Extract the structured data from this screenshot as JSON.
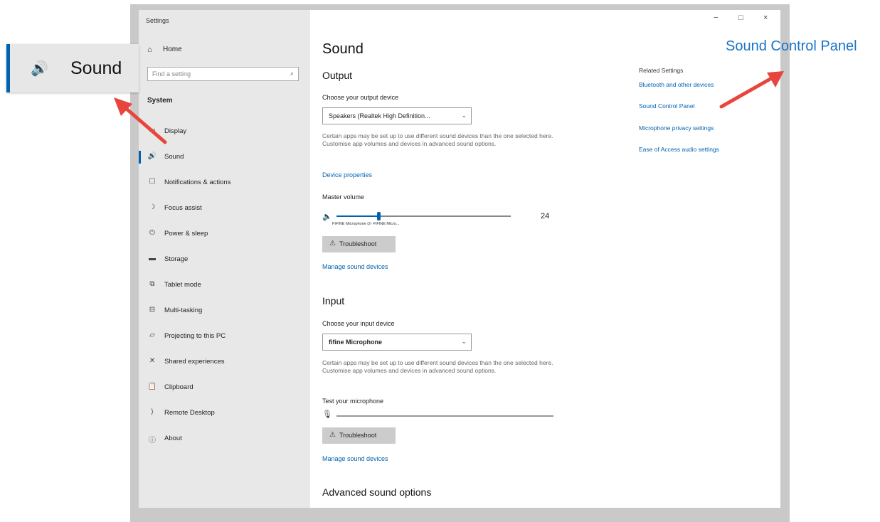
{
  "window": {
    "title": "Settings",
    "controls": {
      "minimize": "−",
      "maximize": "□",
      "close": "×"
    }
  },
  "sidebar": {
    "home_label": "Home",
    "home_icon": "home-icon",
    "search_placeholder": "Find a setting",
    "section_heading": "System",
    "items": [
      {
        "label": "Display",
        "icon": "display-icon",
        "glyph": "▭",
        "active": false
      },
      {
        "label": "Sound",
        "icon": "speaker-icon",
        "glyph": "🔊",
        "active": true
      },
      {
        "label": "Notifications & actions",
        "icon": "notifications-icon",
        "glyph": "☐",
        "active": false
      },
      {
        "label": "Focus assist",
        "icon": "moon-icon",
        "glyph": "☽",
        "active": false
      },
      {
        "label": "Power & sleep",
        "icon": "power-icon",
        "glyph": "⏻",
        "active": false
      },
      {
        "label": "Storage",
        "icon": "storage-icon",
        "glyph": "▬",
        "active": false
      },
      {
        "label": "Tablet mode",
        "icon": "tablet-icon",
        "glyph": "⧉",
        "active": false
      },
      {
        "label": "Multi-tasking",
        "icon": "multitask-icon",
        "glyph": "⊟",
        "active": false
      },
      {
        "label": "Projecting to this PC",
        "icon": "projecting-icon",
        "glyph": "▱",
        "active": false
      },
      {
        "label": "Shared experiences",
        "icon": "shared-icon",
        "glyph": "✕",
        "active": false
      },
      {
        "label": "Clipboard",
        "icon": "clipboard-icon",
        "glyph": "📋",
        "active": false
      },
      {
        "label": "Remote Desktop",
        "icon": "remote-desktop-icon",
        "glyph": "⟩",
        "active": false
      },
      {
        "label": "About",
        "icon": "info-icon",
        "glyph": "ⓘ",
        "active": false
      }
    ]
  },
  "main": {
    "title": "Sound",
    "output": {
      "heading": "Output",
      "choose_label": "Choose your output device",
      "device_value": "Speakers (Realtek High Definition...",
      "description": "Certain apps may be set up to use different sound devices than the one selected here. Customise app volumes and devices in advanced sound options.",
      "device_properties_link": "Device properties",
      "master_volume_label": "Master volume",
      "volume_value": "24",
      "volume_level": 0.24,
      "volume_sublabel": "FIFINE Microphone (2- FIFINE Micro...",
      "troubleshoot_label": "Troubleshoot",
      "manage_link": "Manage sound devices"
    },
    "input": {
      "heading": "Input",
      "choose_label": "Choose your input device",
      "device_value": "fifine Microphone",
      "description": "Certain apps may be set up to use different sound devices than the one selected here. Customise app volumes and devices in advanced sound options.",
      "test_label": "Test your microphone",
      "troubleshoot_label": "Troubleshoot",
      "manage_link": "Manage sound devices"
    },
    "advanced_heading": "Advanced sound options"
  },
  "related": {
    "title": "Related Settings",
    "links": [
      "Bluetooth and other devices",
      "Sound Control Panel",
      "Microphone privacy settings",
      "Ease of Access audio settings"
    ]
  },
  "callouts": {
    "sound_tile_label": "Sound",
    "sound_tile_icon": "speaker-icon",
    "control_panel_label": "Sound Control Panel",
    "accent_color": "#0063b1",
    "arrow_color": "#e8453c"
  }
}
